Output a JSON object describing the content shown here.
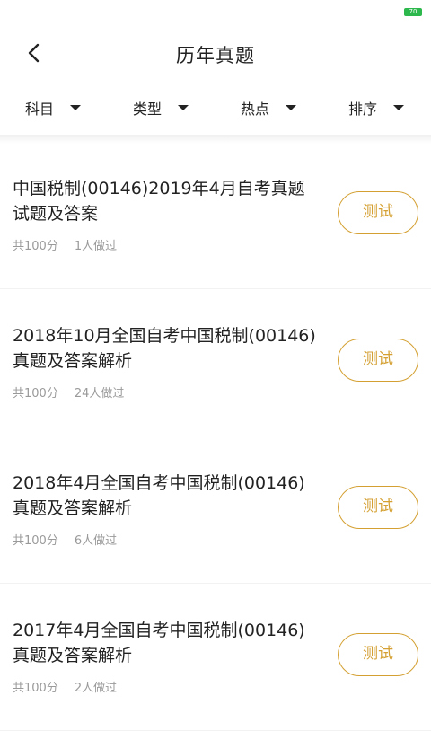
{
  "status_bar": {
    "battery": "70"
  },
  "header": {
    "title": "历年真题"
  },
  "filters": [
    {
      "label": "科目"
    },
    {
      "label": "类型"
    },
    {
      "label": "热点"
    },
    {
      "label": "排序"
    }
  ],
  "items": [
    {
      "title": "中国税制(00146)2019年4月自考真题试题及答案",
      "score": "共100分",
      "count": "1人做过",
      "button": "测试"
    },
    {
      "title": "2018年10月全国自考中国税制(00146)真题及答案解析",
      "score": "共100分",
      "count": "24人做过",
      "button": "测试"
    },
    {
      "title": "2018年4月全国自考中国税制(00146)真题及答案解析",
      "score": "共100分",
      "count": "6人做过",
      "button": "测试"
    },
    {
      "title": "2017年4月全国自考中国税制(00146)真题及答案解析",
      "score": "共100分",
      "count": "2人做过",
      "button": "测试"
    }
  ],
  "colors": {
    "accent": "#d4a032",
    "battery": "#2db84d"
  }
}
